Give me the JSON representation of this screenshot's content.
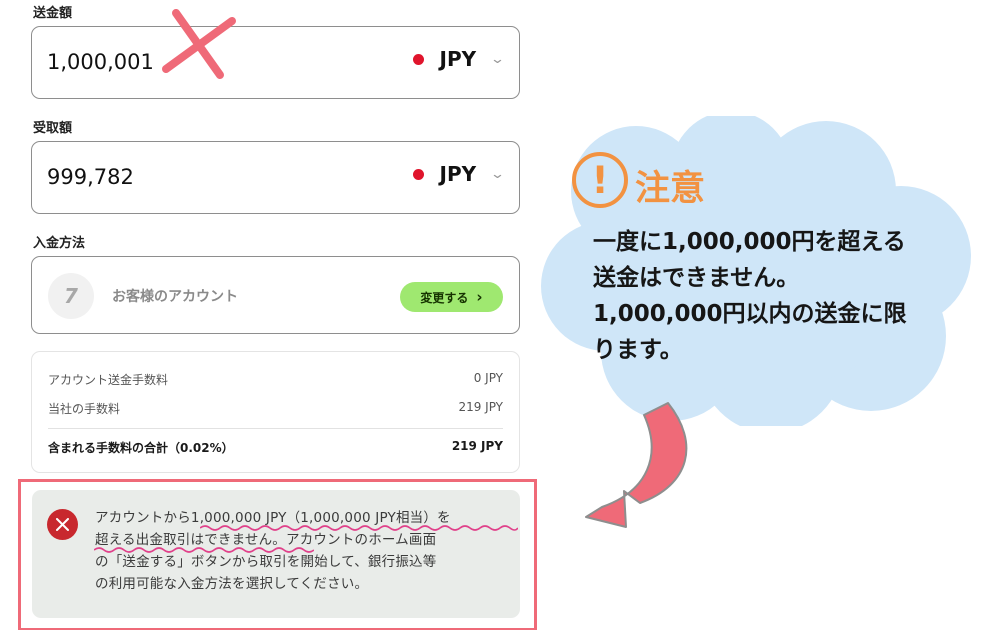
{
  "send": {
    "label": "送金額",
    "amount": "1,000,001",
    "currency": "JPY"
  },
  "receive": {
    "label": "受取額",
    "amount": "999,782",
    "currency": "JPY"
  },
  "payment_method": {
    "label": "入金方法",
    "logo_glyph": "7",
    "account_text": "お客様のアカウント",
    "change_button": "変更する",
    "change_chevron": "›"
  },
  "fees": {
    "rows": [
      {
        "label": "アカウント送金手数料",
        "value": "0 JPY"
      },
      {
        "label": "当社の手数料",
        "value": "219 JPY"
      }
    ],
    "total": {
      "label": "含まれる手数料の合計（0.02%）",
      "value": "219 JPY"
    }
  },
  "alert": {
    "line1": "アカウントから1,000,000 JPY（1,000,000 JPY相当）を",
    "line2": "超える出金取引はできません。アカウントのホーム画面",
    "line3": "の「送金する」ボタンから取引を開始して、銀行振込等",
    "line4": "の利用可能な入金方法を選択してください。"
  },
  "annotation": {
    "icon": "!",
    "title": "注意",
    "body_line1": "一度に1,000,000円を超える",
    "body_line2": "送金はできません。",
    "body_line3": "1,000,000円以内の送金に限",
    "body_line4": "ります。"
  },
  "colors": {
    "accent_green": "#9fe870",
    "warning_orange": "#f29241",
    "error_red": "#c8282e",
    "highlight_pink": "#ef6a78",
    "cloud_blue": "#cfe6f8"
  },
  "icons": [
    "close-mark-icon",
    "chevron-down-icon",
    "wise-logo-icon",
    "error-x-icon",
    "exclamation-icon",
    "curved-arrow-icon"
  ]
}
